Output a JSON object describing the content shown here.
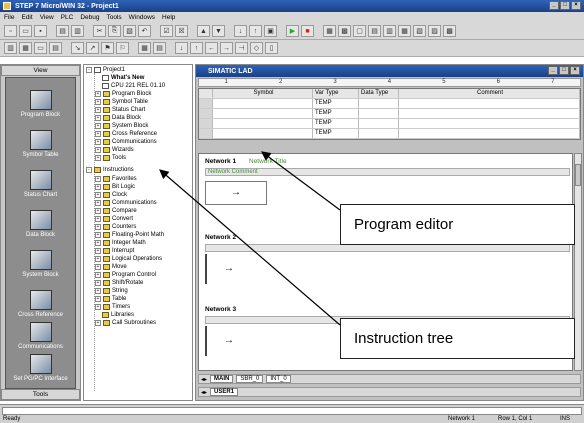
{
  "window": {
    "title": "STEP 7 Micro/WIN 32 - Project1"
  },
  "menu": [
    "File",
    "Edit",
    "View",
    "PLC",
    "Debug",
    "Tools",
    "Windows",
    "Help"
  ],
  "navbar": {
    "header": "View",
    "footer": "Tools",
    "items": [
      "Program Block",
      "Symbol Table",
      "Status Chart",
      "Data Block",
      "System Block",
      "Cross Reference",
      "Communications",
      "Set PG/PC Interface"
    ]
  },
  "tree": {
    "items": [
      "Project1",
      "What's New",
      "CPU 221 REL 01.10",
      "Program Block",
      "Symbol Table",
      "Status Chart",
      "Data Block",
      "System Block",
      "Cross Reference",
      "Communications",
      "Wizards",
      "Tools",
      "Instructions",
      "Favorites",
      "Bit Logic",
      "Clock",
      "Communications",
      "Compare",
      "Convert",
      "Counters",
      "Floating-Point Math",
      "Integer Math",
      "Interrupt",
      "Logical Operations",
      "Move",
      "Program Control",
      "Shift/Rotate",
      "String",
      "Table",
      "Timers",
      "Libraries",
      "Call Subroutines"
    ]
  },
  "editor": {
    "title": "SIMATIC LAD",
    "ruler": [
      "1",
      "2",
      "3",
      "4",
      "5",
      "6",
      "7"
    ],
    "vartable": {
      "headers": [
        "Symbol",
        "Var Type",
        "Data Type",
        "Comment"
      ],
      "rows": [
        "TEMP",
        "TEMP",
        "TEMP",
        "TEMP"
      ]
    },
    "networks": [
      {
        "title": "Network 1",
        "label": "Network Title",
        "comment": "Network Comment"
      },
      {
        "title": "Network 2"
      },
      {
        "title": "Network 3"
      }
    ],
    "tabs1": [
      "MAIN",
      "SBR_0",
      "INT_0"
    ],
    "tabs2": [
      "USER1"
    ]
  },
  "status": {
    "left": "Ready",
    "network": "Network 1",
    "position": "Row 1, Col 1",
    "mode": "INS"
  },
  "callouts": {
    "program_editor": "Program editor",
    "instruction_tree": "Instruction tree"
  }
}
